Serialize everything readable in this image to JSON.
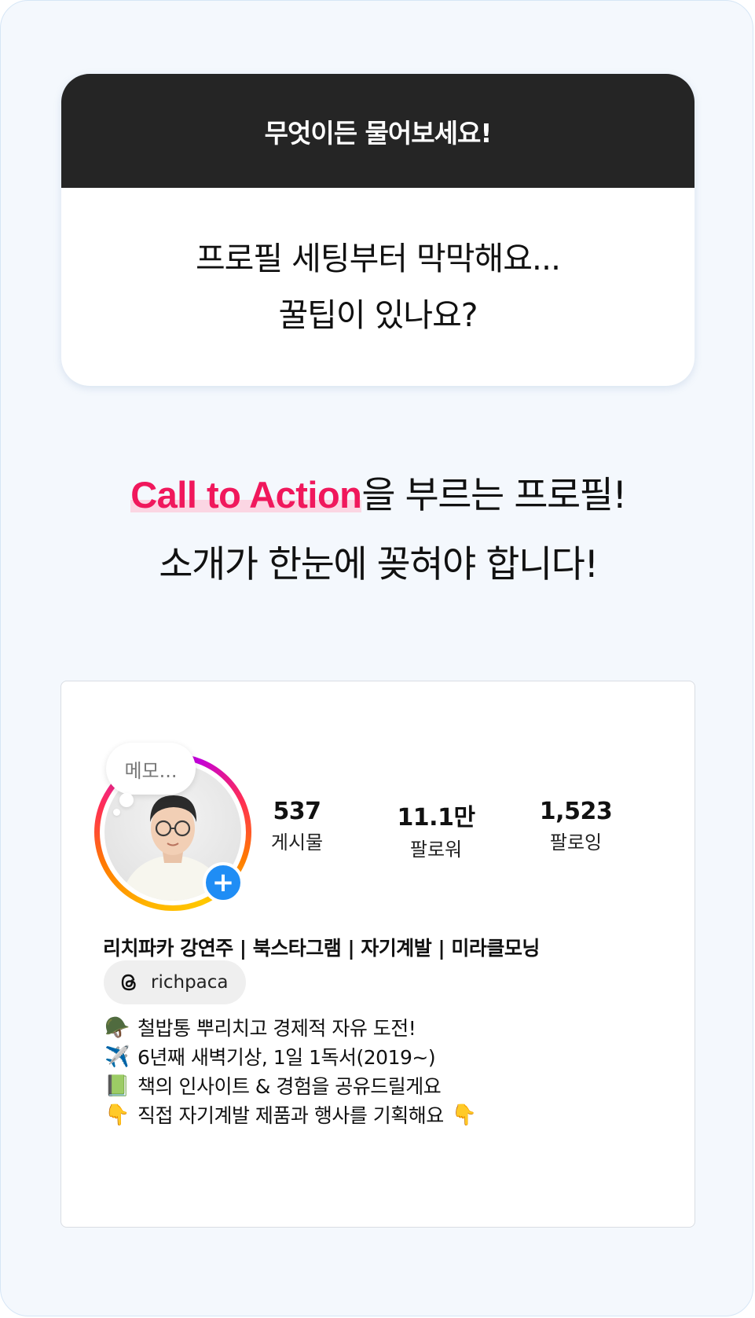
{
  "qa": {
    "header": "무엇이든 물어보세요!",
    "question_lines": [
      "프로필 세팅부터 막막해요...",
      "꿀팁이 있나요?"
    ]
  },
  "headline": {
    "cta": "Call to Action",
    "line1_rest": "을 부르는 프로필!",
    "line2": "소개가 한눈에 꽂혀야 합니다!",
    "cta_color": "#f0185c"
  },
  "profile": {
    "memo": "메모...",
    "stats": [
      {
        "value": "537",
        "label": "게시물"
      },
      {
        "value": "11.1만",
        "label": "팔로워"
      },
      {
        "value": "1,523",
        "label": "팔로잉"
      }
    ],
    "name_line": "리치파카 강연주 | 북스타그램 | 자기계발 | 미라클모닝",
    "threads_handle": "richpaca",
    "bio": [
      {
        "emoji": "🪖",
        "text": "철밥통 뿌리치고 경제적 자유 도전!"
      },
      {
        "emoji": "✈️",
        "text": "6년째 새벽기상, 1일 1독서(2019~)"
      },
      {
        "emoji": "📗",
        "text": "책의 인사이트 & 경험을 공유드릴게요"
      },
      {
        "emoji": "👇",
        "text": "직접 자기계발 제품과 행사를 기획해요",
        "emoji_end": "👇"
      }
    ],
    "add_story_color": "#1f8df5"
  }
}
